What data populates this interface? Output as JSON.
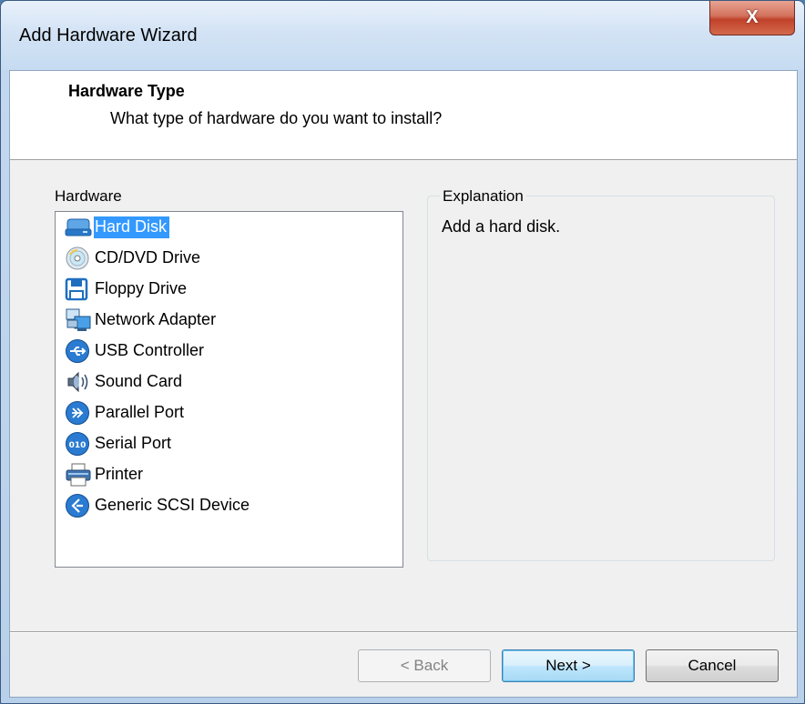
{
  "window": {
    "title": "Add Hardware Wizard",
    "close_label": "X"
  },
  "header": {
    "title": "Hardware Type",
    "subtitle": "What type of hardware do you want to install?"
  },
  "hardware": {
    "label": "Hardware",
    "selected_index": 0,
    "items": [
      {
        "label": "Hard Disk",
        "icon": "hard-disk-icon"
      },
      {
        "label": "CD/DVD Drive",
        "icon": "cd-dvd-icon"
      },
      {
        "label": "Floppy Drive",
        "icon": "floppy-icon"
      },
      {
        "label": "Network Adapter",
        "icon": "network-adapter-icon"
      },
      {
        "label": "USB Controller",
        "icon": "usb-icon"
      },
      {
        "label": "Sound Card",
        "icon": "sound-card-icon"
      },
      {
        "label": "Parallel Port",
        "icon": "parallel-port-icon"
      },
      {
        "label": "Serial Port",
        "icon": "serial-port-icon"
      },
      {
        "label": "Printer",
        "icon": "printer-icon"
      },
      {
        "label": "Generic SCSI Device",
        "icon": "scsi-icon"
      }
    ]
  },
  "explanation": {
    "label": "Explanation",
    "text": "Add a hard disk."
  },
  "buttons": {
    "back": "< Back",
    "next": "Next >",
    "cancel": "Cancel"
  },
  "colors": {
    "selection": "#3399ff",
    "close_button": "#c7492f",
    "icon_blue": "#1e73c8"
  }
}
